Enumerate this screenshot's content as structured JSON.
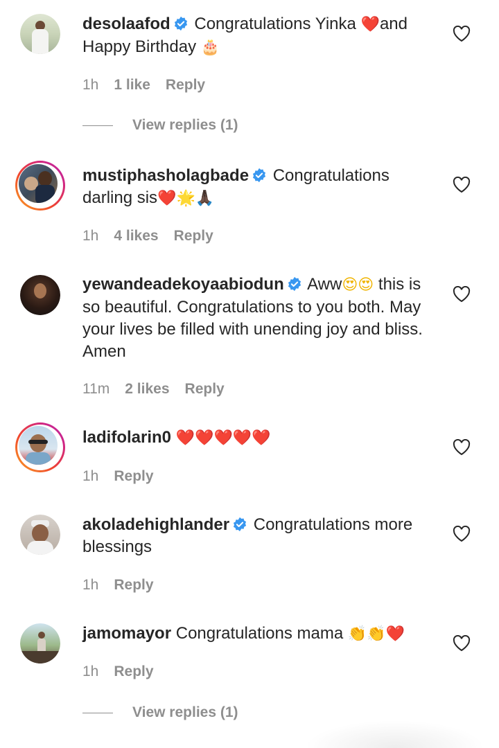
{
  "icons": {
    "verified": "verified-badge-icon",
    "like": "heart-outline-icon"
  },
  "colors": {
    "verified": "#3897f0",
    "muted": "#8e8e8e",
    "text": "#262626",
    "heart_emoji": "#e0245e"
  },
  "comments": [
    {
      "username": "desolaafod",
      "verified": true,
      "text_a": "Congratulations Yinka ",
      "emoji_a": "❤️",
      "text_b": "and Happy Birthday ",
      "emoji_b": "🎂",
      "time": "1h",
      "likes": "1 like",
      "reply": "Reply",
      "view_replies": "View replies (1)"
    },
    {
      "username": "mustiphasholagbade",
      "verified": true,
      "text_a": "Congratulations darling sis",
      "emoji_a": "❤️🌟🙏🏿",
      "time": "1h",
      "likes": "4 likes",
      "reply": "Reply"
    },
    {
      "username": "yewandeadekoyaabiodun",
      "verified": true,
      "text_a": "Aww",
      "emoji_a": "😍😍",
      "text_b": " this is so beautiful. Congratulations to you both. May your lives be filled with unending joy and bliss. Amen",
      "time": "11m",
      "likes": "2 likes",
      "reply": "Reply"
    },
    {
      "username": "ladifolarin0",
      "verified": false,
      "emoji_a": "❤️❤️❤️❤️❤️",
      "time": "1h",
      "reply": "Reply"
    },
    {
      "username": "akoladehighlander",
      "verified": true,
      "text_a": "Congratulations more blessings",
      "time": "1h",
      "reply": "Reply"
    },
    {
      "username": "jamomayor",
      "verified": false,
      "text_a": "Congratulations mama ",
      "emoji_a": "👏👏❤️",
      "time": "1h",
      "reply": "Reply",
      "view_replies": "View replies (1)"
    }
  ]
}
